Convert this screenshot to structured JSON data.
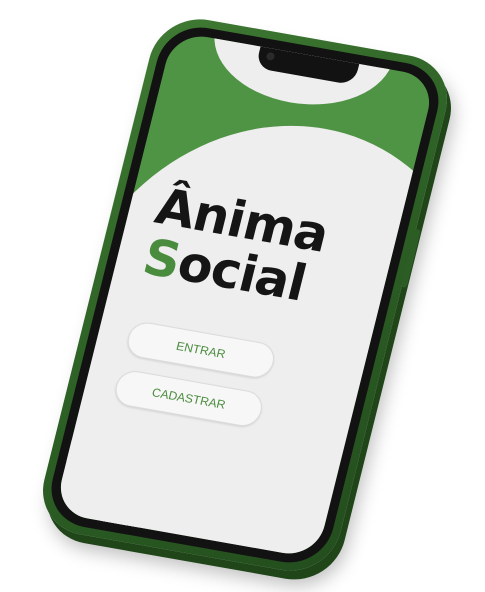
{
  "app": {
    "title_line1": "Ânima",
    "title_line2_initial": "S",
    "title_line2_rest": "ocial"
  },
  "buttons": {
    "enter_label": "ENTRAR",
    "register_label": "CADASTRAR"
  },
  "colors": {
    "brand_green": "#4a8c3e",
    "phone_green": "#2e6226",
    "screen_light": "#eeeeee",
    "text_dark": "#151515"
  }
}
